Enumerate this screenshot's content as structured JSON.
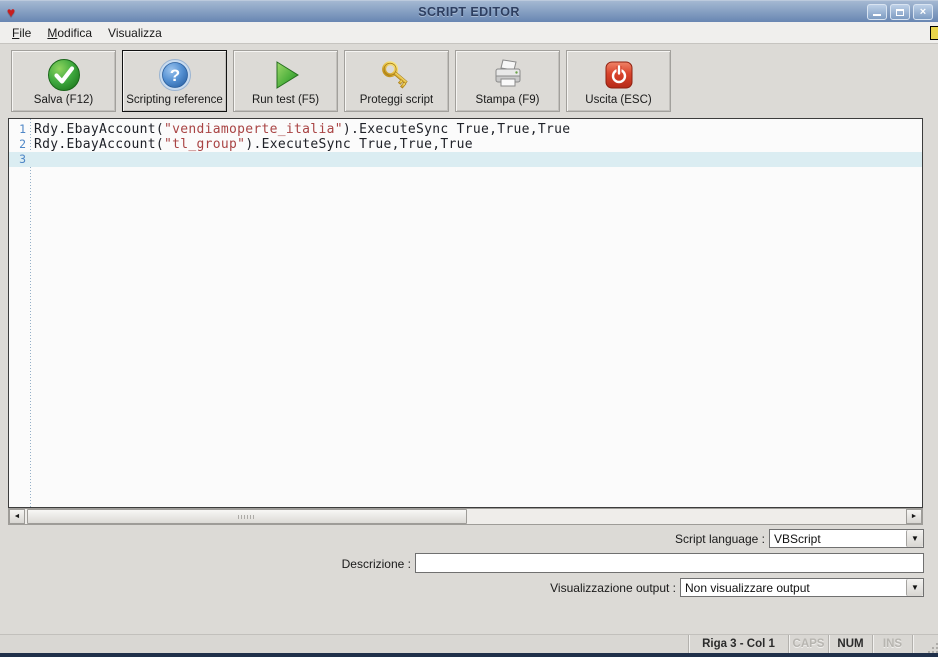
{
  "window": {
    "title": "SCRIPT EDITOR"
  },
  "icons": {
    "heart": "♥",
    "close": "×",
    "scroll_left": "◄",
    "scroll_right": "►",
    "dropdown_arrow": "▼"
  },
  "menu": {
    "items": [
      {
        "head": "F",
        "tail": "ile"
      },
      {
        "head": "M",
        "tail": "odifica"
      },
      {
        "head": "",
        "tail": "Visualizza"
      }
    ]
  },
  "toolbar": {
    "buttons": [
      {
        "label": "Salva (F12)",
        "icon": "green-check-icon"
      },
      {
        "label": "Scripting reference",
        "icon": "blue-question-icon",
        "focused": true
      },
      {
        "label": "Run test (F5)",
        "icon": "green-play-icon"
      },
      {
        "label": "Proteggi script",
        "icon": "gold-key-icon"
      },
      {
        "label": "Stampa (F9)",
        "icon": "printer-icon"
      },
      {
        "label": "Uscita (ESC)",
        "icon": "red-power-icon"
      }
    ]
  },
  "editor": {
    "language_hint": "VBScript",
    "lines": [
      {
        "number": "1",
        "current": false,
        "segments": [
          {
            "type": "code",
            "text": "Rdy.EbayAccount("
          },
          {
            "type": "string",
            "text": "\"vendiamoperte_italia\""
          },
          {
            "type": "code",
            "text": ").ExecuteSync True,True,True"
          }
        ]
      },
      {
        "number": "2",
        "current": false,
        "segments": [
          {
            "type": "code",
            "text": "Rdy.EbayAccount("
          },
          {
            "type": "string",
            "text": "\"tl_group\""
          },
          {
            "type": "code",
            "text": ").ExecuteSync True,True,True"
          }
        ]
      },
      {
        "number": "3",
        "current": true,
        "segments": []
      }
    ]
  },
  "form": {
    "script_language_label": "Script language :",
    "script_language_value": "VBScript",
    "description_label": "Descrizione :",
    "description_value": "",
    "output_label": "Visualizzazione output :",
    "output_value": "Non visualizzare output"
  },
  "statusbar": {
    "position": "Riga 3 - Col 1",
    "caps": "CAPS",
    "num": "NUM",
    "ins": "INS"
  },
  "colors": {
    "titlebar_top": "#A4B8D2",
    "titlebar_bottom": "#6886B2",
    "string_literal": "#A94444",
    "current_line": "#DBEDF2",
    "line_number": "#4E86C6"
  }
}
